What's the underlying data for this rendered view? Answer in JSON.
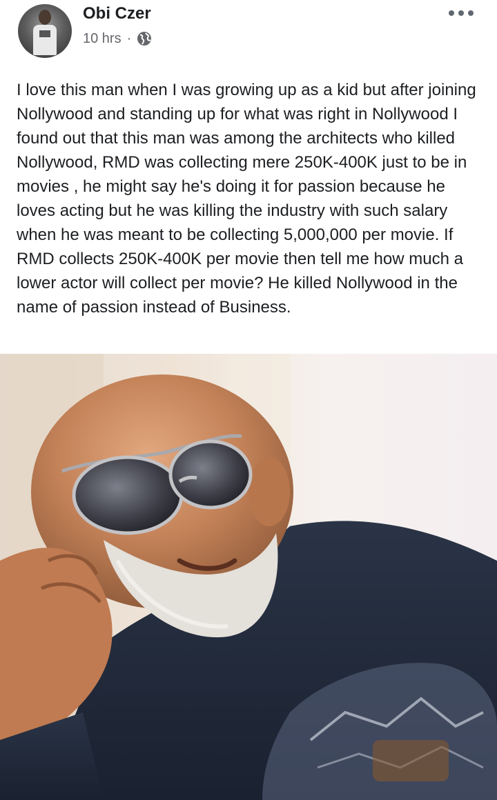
{
  "post": {
    "author": "Obi Czer",
    "time": "10 hrs",
    "separator": "·",
    "text": "I love this man when I was growing up as a kid but after joining Nollywood and standing up for what was right in Nollywood I found out that this man was among the architects who killed Nollywood, RMD was collecting mere 250K-400K just to be in movies , he might say he's doing it for passion because he loves acting but he was killing the industry with such salary when he was meant to be collecting 5,000,000 per movie. If RMD collects 250K-400K per movie then tell me how much a lower actor will collect per movie? He killed Nollywood in the name of passion instead of Business.",
    "privacy_icon": "globe-icon",
    "menu_icon": "more-options-icon"
  },
  "colors": {
    "text": "#1c1e21",
    "meta": "#65676b",
    "background": "#ffffff"
  }
}
